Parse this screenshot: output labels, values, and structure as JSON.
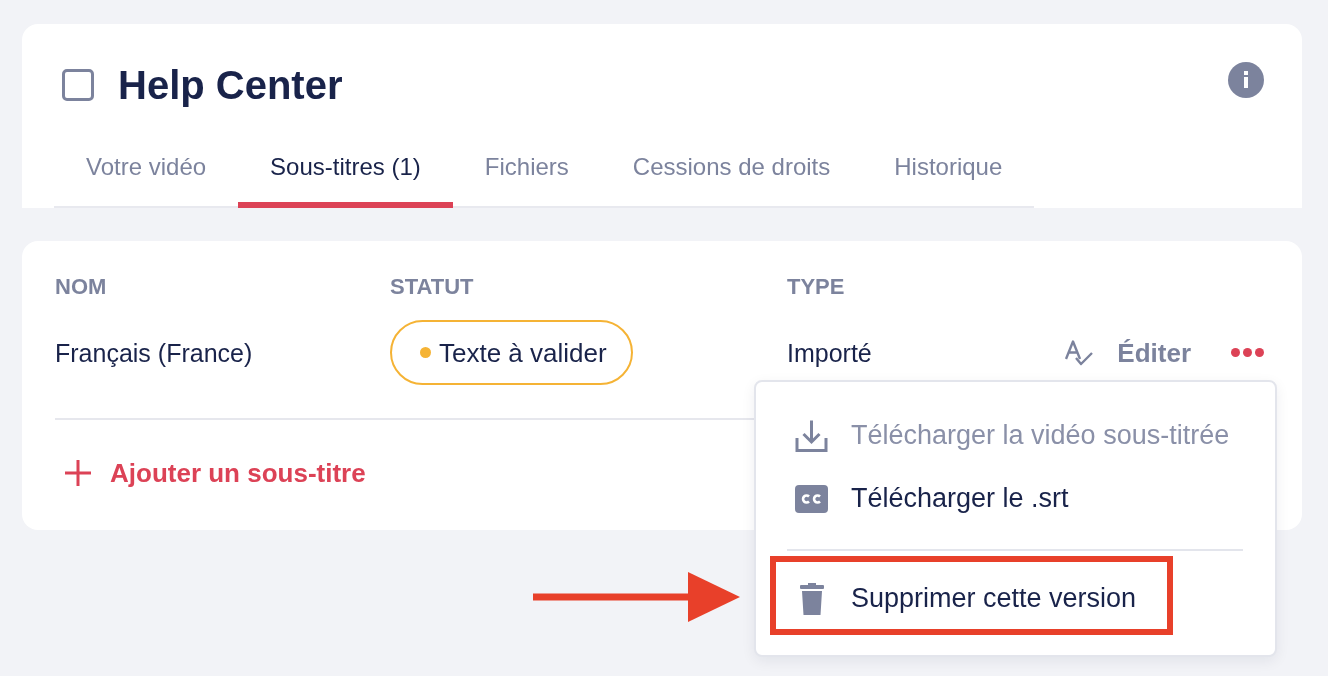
{
  "header": {
    "checked": false,
    "title": "Help Center"
  },
  "tabs": [
    {
      "label": "Votre vidéo",
      "selected": false
    },
    {
      "label": "Sous-titres (1)",
      "selected": true
    },
    {
      "label": "Fichiers",
      "selected": false
    },
    {
      "label": "Cessions de droits",
      "selected": false
    },
    {
      "label": "Historique",
      "selected": false
    }
  ],
  "table": {
    "columns": [
      "NOM",
      "STATUT",
      "TYPE"
    ],
    "rows": [
      {
        "name": "Français (France)",
        "status": {
          "label": "Texte à valider",
          "color": "#f5b335"
        },
        "type": "Importé",
        "edit_label": "Éditer"
      }
    ]
  },
  "add_link": "Ajouter un sous-titre",
  "menu": {
    "items": [
      {
        "kind": "download",
        "label": "Télécharger la vidéo sous-titrée",
        "disabled": true,
        "highlighted": false
      },
      {
        "kind": "subtitles",
        "label": "Télécharger le .srt",
        "disabled": false,
        "highlighted": false
      },
      {
        "kind": "delete",
        "label": "Supprimer cette version",
        "disabled": false,
        "highlighted": true
      }
    ]
  }
}
